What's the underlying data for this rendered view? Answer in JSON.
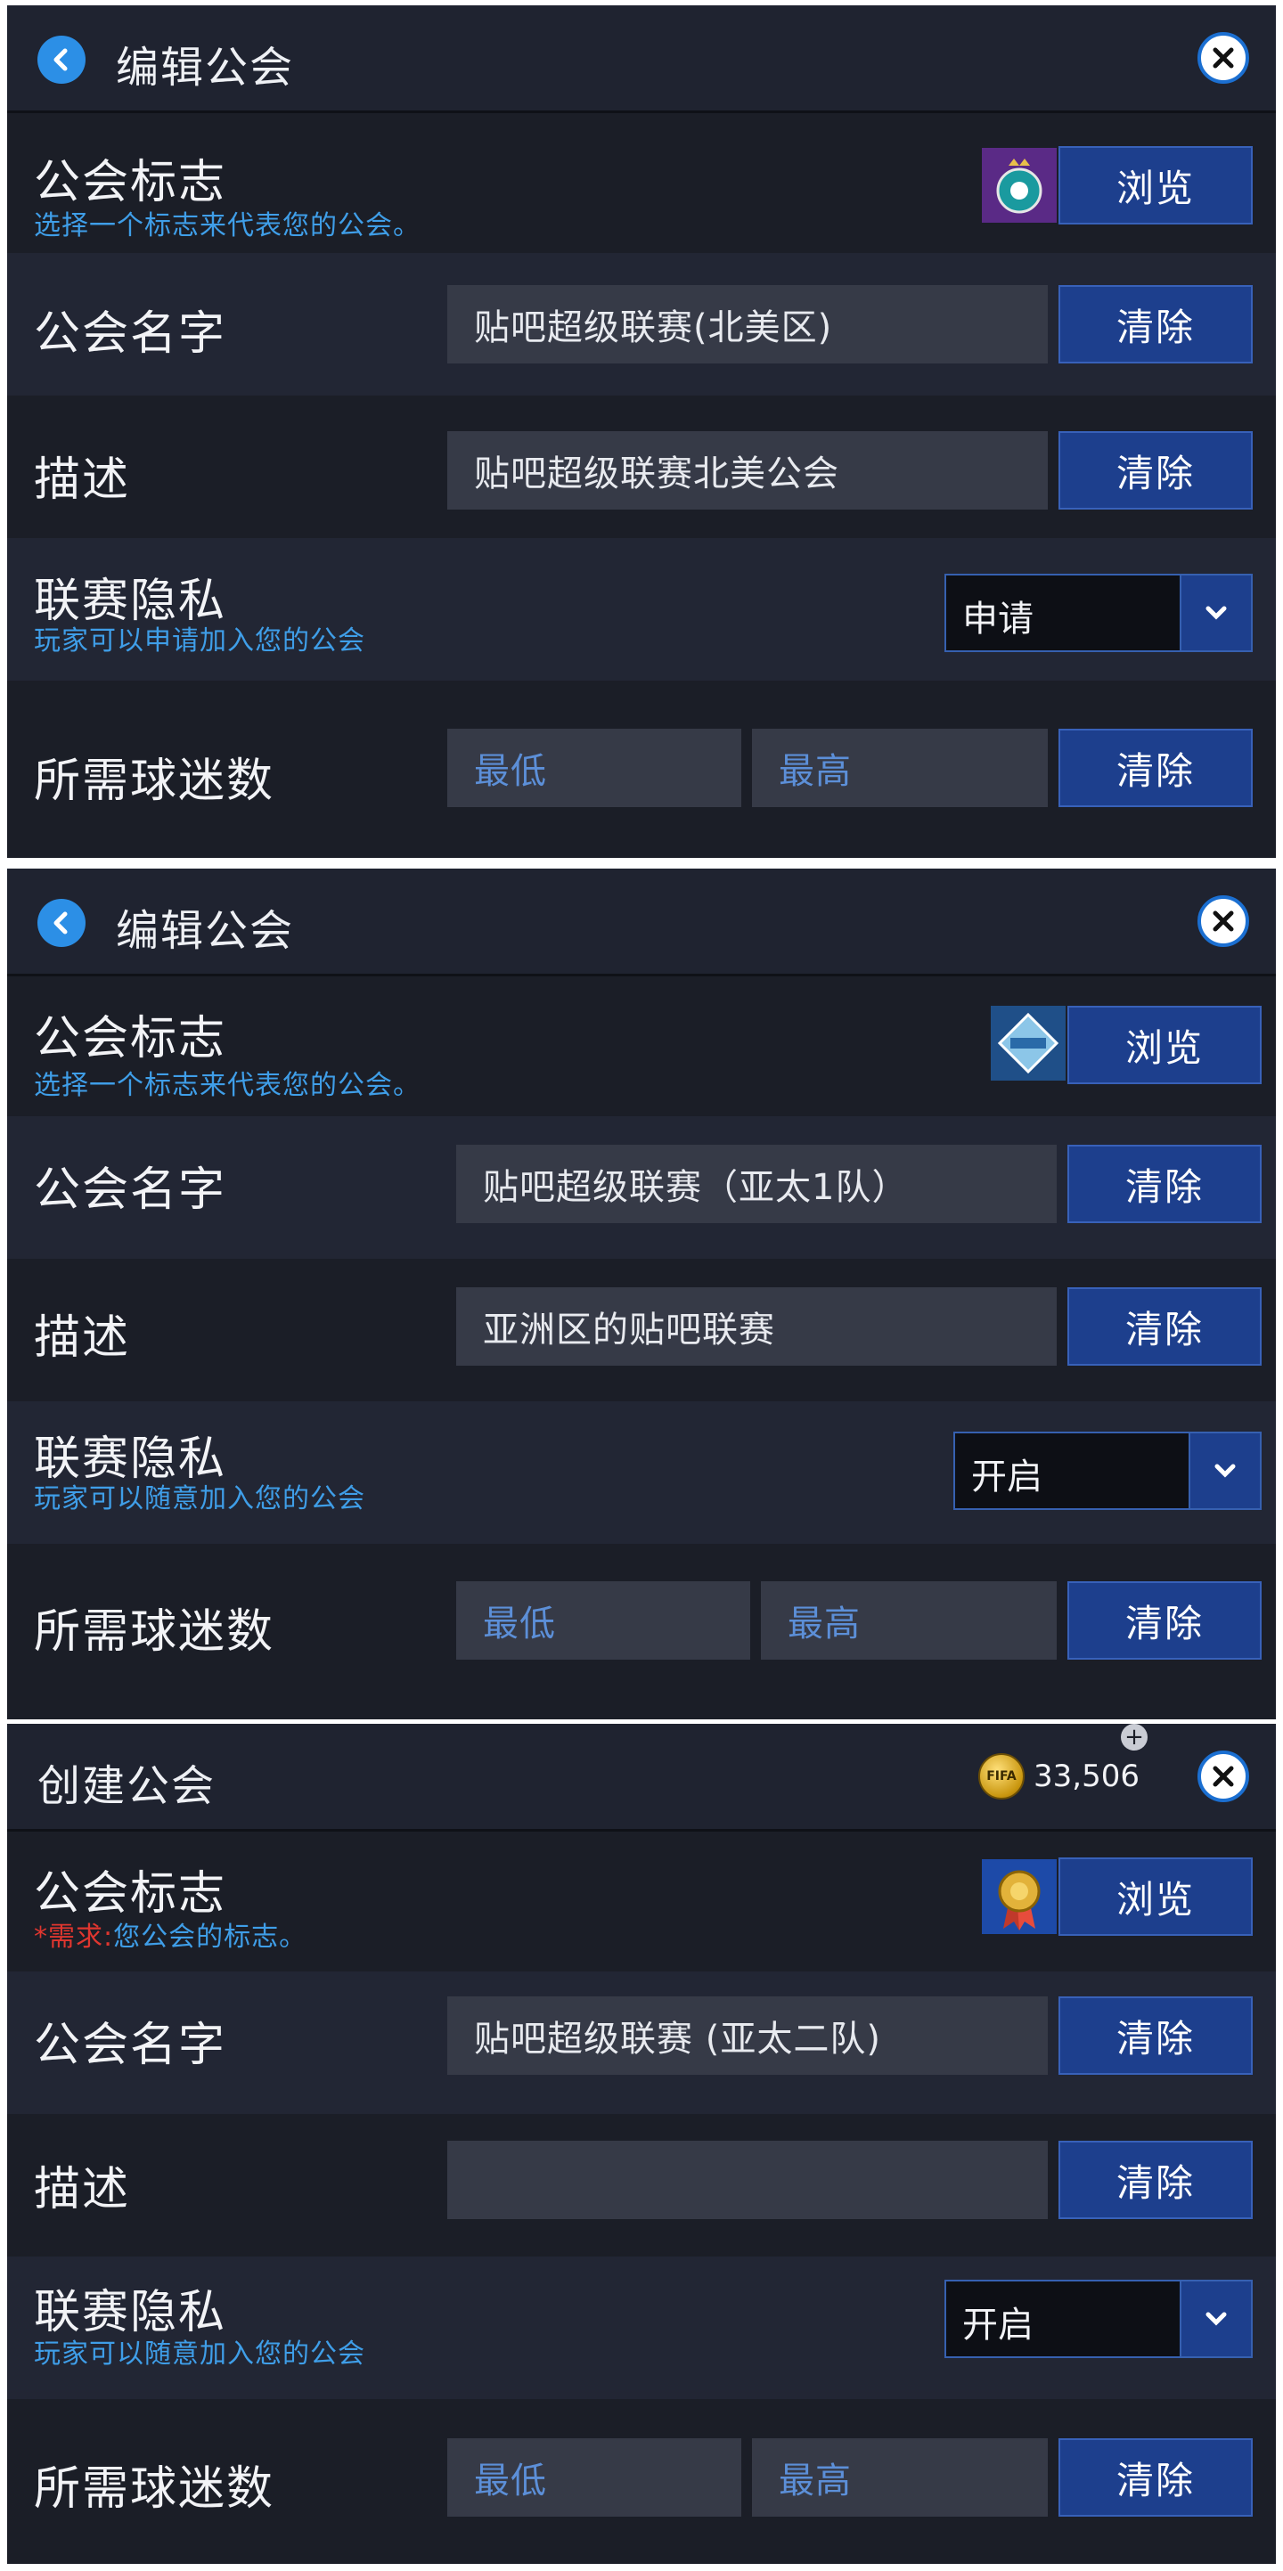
{
  "panels": [
    {
      "title": "编辑公会",
      "logo": {
        "label": "公会标志",
        "hint": "选择一个标志来代表您的公会。",
        "browse": "浏览"
      },
      "name": {
        "label": "公会名字",
        "value": "贴吧超级联赛(北美区)",
        "clear": "清除"
      },
      "desc": {
        "label": "描述",
        "value": "贴吧超级联赛北美公会",
        "clear": "清除"
      },
      "privacy": {
        "label": "联赛隐私",
        "hint": "玩家可以申请加入您的公会",
        "value": "申请"
      },
      "fans": {
        "label": "所需球迷数",
        "min": "最低",
        "max": "最高",
        "clear": "清除"
      }
    },
    {
      "title": "编辑公会",
      "logo": {
        "label": "公会标志",
        "hint": "选择一个标志来代表您的公会。",
        "browse": "浏览"
      },
      "name": {
        "label": "公会名字",
        "value": "贴吧超级联赛（亚太1队）",
        "clear": "清除"
      },
      "desc": {
        "label": "描述",
        "value": "亚洲区的贴吧联赛",
        "clear": "清除"
      },
      "privacy": {
        "label": "联赛隐私",
        "hint": "玩家可以随意加入您的公会",
        "value": "开启"
      },
      "fans": {
        "label": "所需球迷数",
        "min": "最低",
        "max": "最高",
        "clear": "清除"
      }
    },
    {
      "title": "创建公会",
      "coins": "33,506",
      "coin_icon_text": "FIFA",
      "logo": {
        "label": "公会标志",
        "hint_required": "*需求:",
        "hint": "您公会的标志。",
        "browse": "浏览"
      },
      "name": {
        "label": "公会名字",
        "value": "贴吧超级联赛 (亚太二队)",
        "clear": "清除"
      },
      "desc": {
        "label": "描述",
        "value": "",
        "clear": "清除"
      },
      "privacy": {
        "label": "联赛隐私",
        "hint": "玩家可以随意加入您的公会",
        "value": "开启"
      },
      "fans": {
        "label": "所需球迷数",
        "min": "最低",
        "max": "最高",
        "clear": "清除"
      }
    }
  ],
  "icons": {
    "back": "back-arrow-icon",
    "close": "close-icon",
    "caret": "chevron-down-icon",
    "coin": "fifa-coin-icon",
    "add": "plus-icon"
  },
  "colors": {
    "panel_bg": "#1b1e27",
    "accent_blue": "#1d3f8d",
    "hint_blue": "#3f9ee8",
    "required_red": "#e0362f"
  }
}
